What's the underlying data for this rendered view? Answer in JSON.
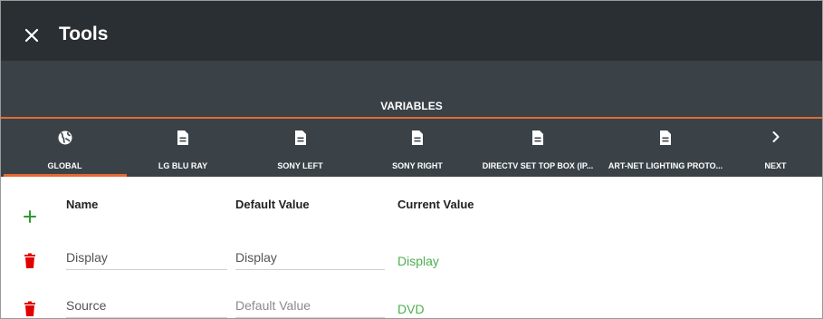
{
  "header": {
    "title": "Tools"
  },
  "variables_section": {
    "label": "VARIABLES"
  },
  "tabs": [
    {
      "label": "GLOBAL",
      "icon": "globe-icon"
    },
    {
      "label": "LG BLU RAY",
      "icon": "document-icon"
    },
    {
      "label": "SONY LEFT",
      "icon": "document-icon"
    },
    {
      "label": "SONY RIGHT",
      "icon": "document-icon"
    },
    {
      "label": "DIRECTV SET TOP BOX (IP...",
      "icon": "document-icon"
    },
    {
      "label": "ART-NET LIGHTING PROTO...",
      "icon": "document-icon"
    },
    {
      "label": "NEXT",
      "icon": "chevron-right-icon"
    }
  ],
  "table": {
    "columns": {
      "name": "Name",
      "default": "Default Value",
      "current": "Current Value"
    },
    "rows": [
      {
        "name": "Display",
        "default": "Display",
        "current": "Display"
      },
      {
        "name": "Source",
        "default_placeholder": "Default Value",
        "current": "DVD"
      }
    ]
  },
  "colors": {
    "accent": "#e26b34",
    "topbar": "#2a2f33",
    "toolbar": "#3b4247",
    "add": "#2e9a2e",
    "delete": "#e00000",
    "current_value": "#4caf50"
  }
}
